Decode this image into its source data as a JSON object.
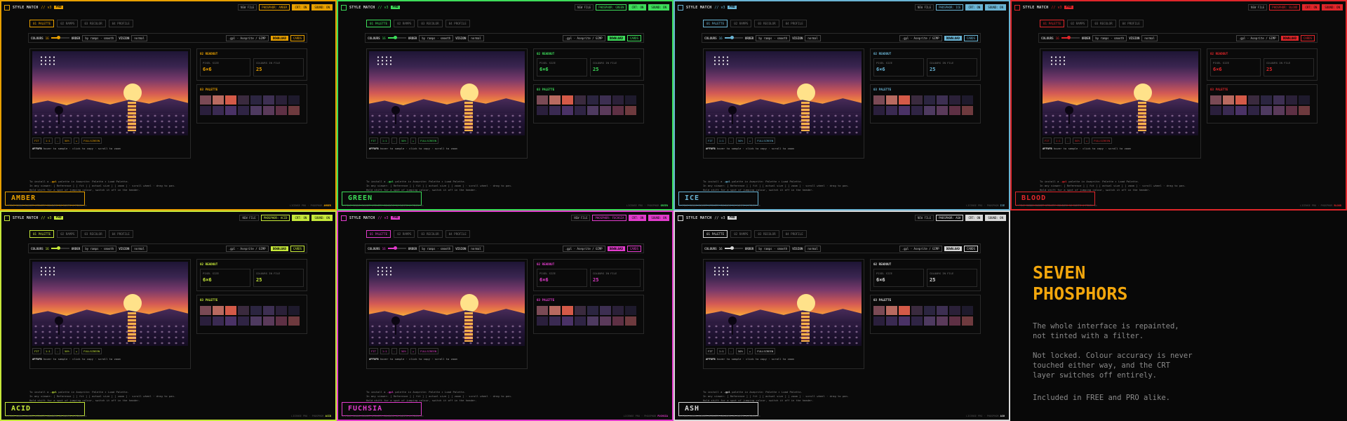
{
  "app": {
    "title": "STYLE MATCH",
    "version": "// v3",
    "pro": "PRO"
  },
  "toolbar": {
    "new_file": "NEW FILE",
    "phosphor_prefix": "PHOSPHOR:",
    "crt": "CRT: ON",
    "sound": "SOUND: ON"
  },
  "tabs": [
    "01 PALETTE",
    "02 RAMPS",
    "03 RECOLOR",
    "04 PROFILE"
  ],
  "controls": {
    "colours_label": "COLOURS",
    "colours_value": "16",
    "order_label": "ORDER",
    "order_value": "by ramps · smooth",
    "vision_label": "VISION",
    "vision_value": "normal",
    "format": ".gpl · Aseprite / GIMP",
    "download": "DOWNLOAD",
    "cards": "CARDS"
  },
  "zoom": {
    "fit": "FIT",
    "ratio": "1:1",
    "minus": "-",
    "pct": "50%",
    "plus": "+",
    "full": "FULLSCREEN"
  },
  "hover": {
    "code": "#FF8FB",
    "text": "hover to sample · click to copy · scroll to zoom"
  },
  "readout": {
    "title": "02 READOUT",
    "pixel_label": "PIXEL SIZE",
    "pixel_value": "6×6",
    "colours_label": "COLOURS IN FILE",
    "colours_value": "25"
  },
  "palette": {
    "title": "03 PALETTE",
    "swatches": [
      "#7a4a55",
      "#b86a60",
      "#d45a48",
      "#3a2a3e",
      "#2b2540",
      "#3d2f52",
      "#2a2038",
      "#1e1a2c",
      "#2a1f3c",
      "#3a2a52",
      "#4a3266",
      "#2f2444",
      "#4e3a60",
      "#5a3a5a",
      "#5e3044",
      "#6e3a3e"
    ]
  },
  "help": {
    "line1_a": "To install a",
    "gpl": ".gpl",
    "line1_b": "palette in Aseprite: Palette ▸ Load Palette.",
    "line2": "In any viewer: [ Reference ] [ fit ] [ actual size ] [ zoom ] · scroll wheel · drag to pan.",
    "line3": "Hold shift for a spot of jumping colour, switch it off in the header."
  },
  "status": {
    "left": "▸ FILE SUNNS-SUNSET UTILITY COLOURS 16 RAMPS 4 PIXEL 6×",
    "right": "LICENSE PRO · PHOSPHOR"
  },
  "themes": [
    {
      "name": "AMBER",
      "color": "#e8a000"
    },
    {
      "name": "GREEN",
      "color": "#3ddc5a"
    },
    {
      "name": "ICE",
      "color": "#6ab4d4"
    },
    {
      "name": "BLOOD",
      "color": "#e0262a"
    },
    {
      "name": "ACID",
      "color": "#c6e83a"
    },
    {
      "name": "FUCHSIA",
      "color": "#e23ccc"
    },
    {
      "name": "ASH",
      "color": "#d8d8d8"
    }
  ],
  "info": {
    "title_line1": "SEVEN",
    "title_line2": "PHOSPHORS",
    "p1": "The whole interface is repainted, not tinted with a filter.",
    "p2": "Not locked. Colour accuracy is never touched either way, and the CRT layer switches off entirely.",
    "p3": "Included in FREE and PRO alike."
  }
}
